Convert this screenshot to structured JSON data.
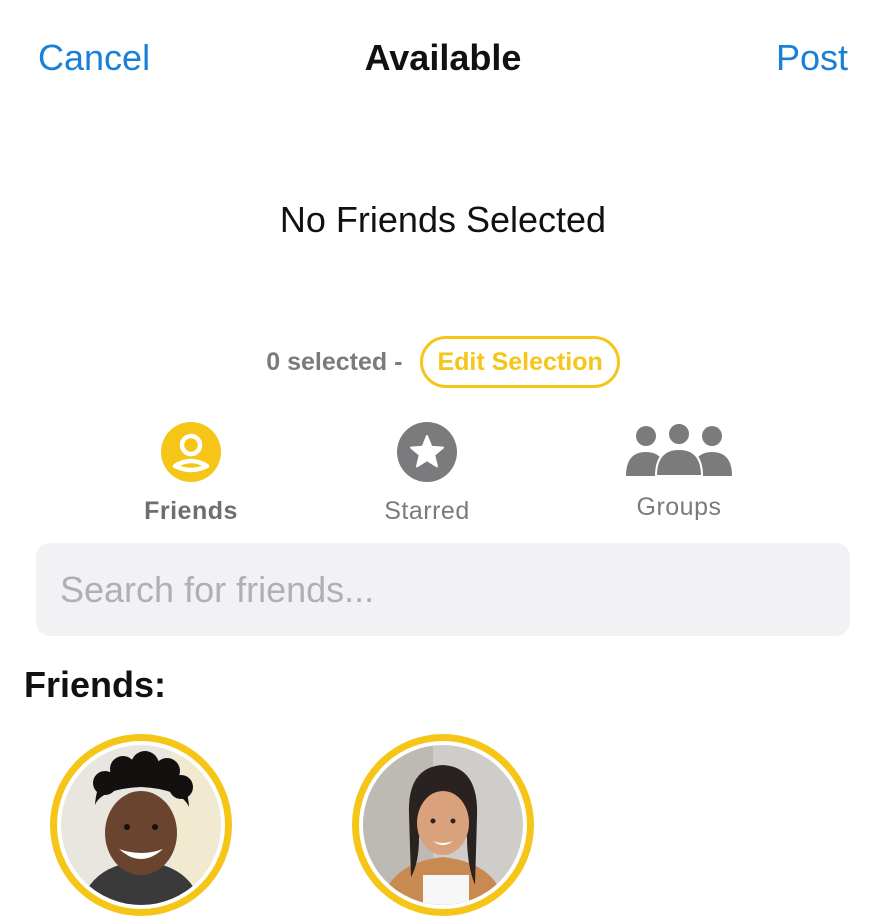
{
  "nav": {
    "cancel_label": "Cancel",
    "title": "Available",
    "post_label": "Post"
  },
  "headline": "No Friends Selected",
  "selection": {
    "count_text": "0 selected -",
    "edit_label": "Edit Selection"
  },
  "tabs": [
    {
      "label": "Friends",
      "icon": "person-circle-icon",
      "active": true
    },
    {
      "label": "Starred",
      "icon": "star-circle-icon",
      "active": false
    },
    {
      "label": "Groups",
      "icon": "group-icon",
      "active": false
    }
  ],
  "search": {
    "placeholder": "Search for friends...",
    "value": ""
  },
  "friends_section": {
    "title": "Friends:"
  },
  "friends": [
    {
      "avatar": "friend-1-photo",
      "selected": false
    },
    {
      "avatar": "friend-2-photo",
      "selected": false
    }
  ],
  "colors": {
    "accent": "#f5c518",
    "link": "#1a7fd6",
    "muted": "#7b7b7b",
    "search_bg": "#f2f2f4"
  }
}
